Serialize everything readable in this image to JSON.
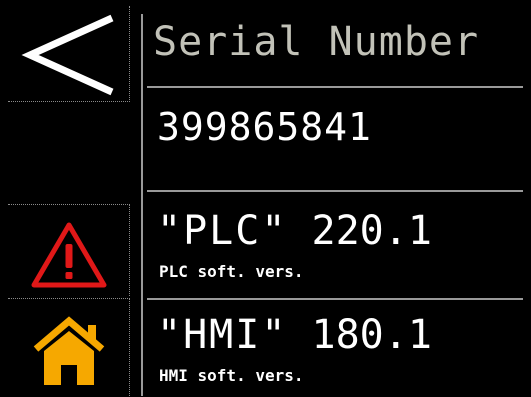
{
  "header": {
    "title": "Serial Number"
  },
  "serial": {
    "value": "399865841"
  },
  "rows": [
    {
      "name": "\"PLC\"",
      "version": "220.1",
      "caption": "PLC soft. vers."
    },
    {
      "name": "\"HMI\"",
      "version": "180.1",
      "caption": "HMI soft. vers."
    }
  ],
  "sidebar": {
    "back_icon": "back-arrow-icon",
    "alarm_icon": "warning-icon",
    "home_icon": "home-icon"
  },
  "colors": {
    "background": "#000000",
    "title_text": "#c2c2b8",
    "value_text": "#ffffff",
    "divider": "#9a9a9a",
    "warning_red": "#e01818",
    "home_orange": "#f6a800"
  }
}
